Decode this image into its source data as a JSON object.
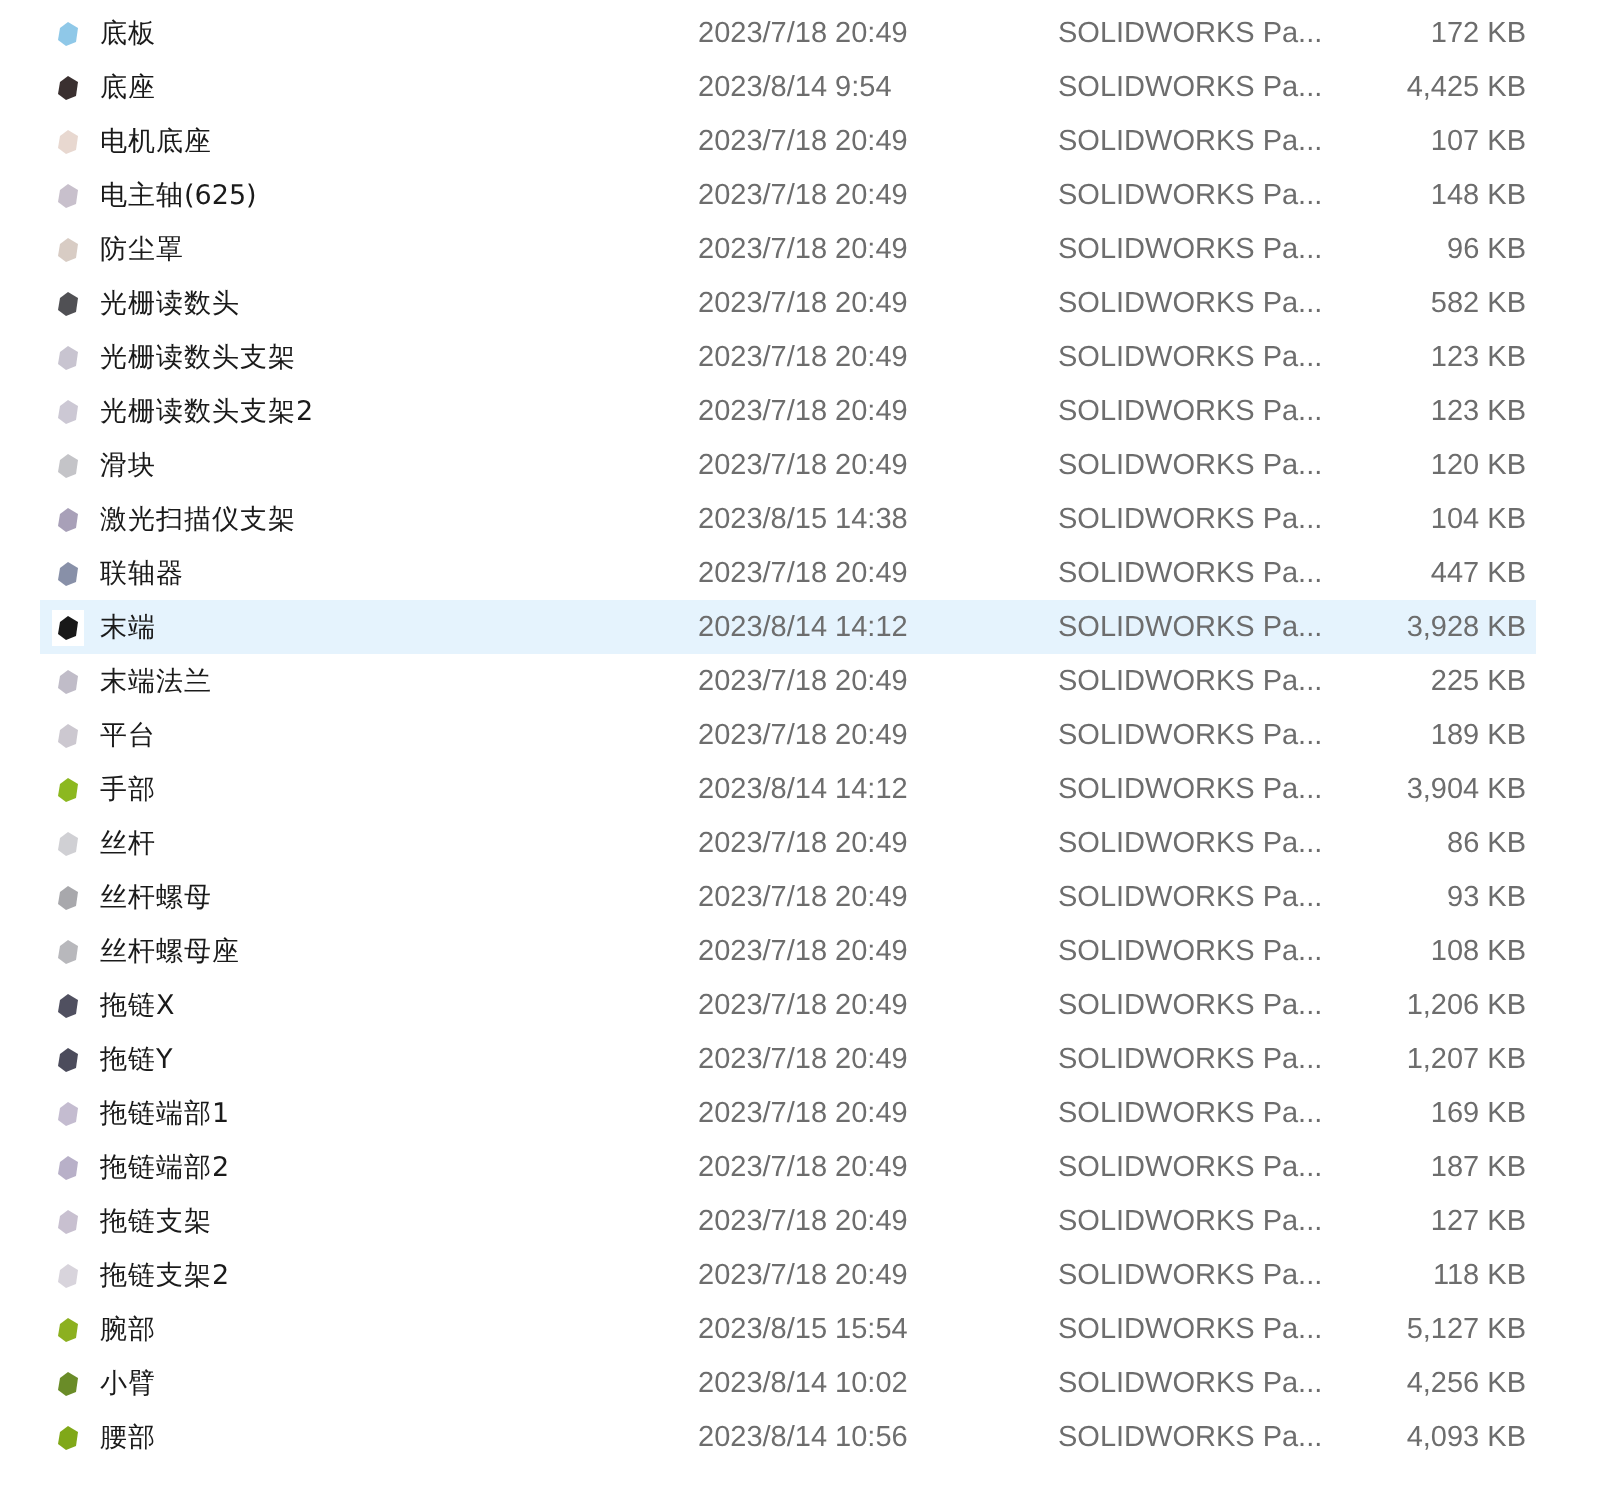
{
  "files": [
    {
      "name": "底板",
      "modified": "2023/7/18 20:49",
      "type": "SOLIDWORKS Pa...",
      "size": "172 KB",
      "selected": false,
      "color": "#8fc8e8"
    },
    {
      "name": "底座",
      "modified": "2023/8/14 9:54",
      "type": "SOLIDWORKS Pa...",
      "size": "4,425 KB",
      "selected": false,
      "color": "#3a3030"
    },
    {
      "name": "电机底座",
      "modified": "2023/7/18 20:49",
      "type": "SOLIDWORKS Pa...",
      "size": "107 KB",
      "selected": false,
      "color": "#e8d8d0"
    },
    {
      "name": "电主轴(625)",
      "modified": "2023/7/18 20:49",
      "type": "SOLIDWORKS Pa...",
      "size": "148 KB",
      "selected": false,
      "color": "#c8c0cc"
    },
    {
      "name": "防尘罩",
      "modified": "2023/7/18 20:49",
      "type": "SOLIDWORKS Pa...",
      "size": "96 KB",
      "selected": false,
      "color": "#d8ccc4"
    },
    {
      "name": "光栅读数头",
      "modified": "2023/7/18 20:49",
      "type": "SOLIDWORKS Pa...",
      "size": "582 KB",
      "selected": false,
      "color": "#505054"
    },
    {
      "name": "光栅读数头支架",
      "modified": "2023/7/18 20:49",
      "type": "SOLIDWORKS Pa...",
      "size": "123 KB",
      "selected": false,
      "color": "#c8c4d0"
    },
    {
      "name": "光栅读数头支架2",
      "modified": "2023/7/18 20:49",
      "type": "SOLIDWORKS Pa...",
      "size": "123 KB",
      "selected": false,
      "color": "#ccc8d4"
    },
    {
      "name": "滑块",
      "modified": "2023/7/18 20:49",
      "type": "SOLIDWORKS Pa...",
      "size": "120 KB",
      "selected": false,
      "color": "#c4c4c8"
    },
    {
      "name": "激光扫描仪支架",
      "modified": "2023/8/15 14:38",
      "type": "SOLIDWORKS Pa...",
      "size": "104 KB",
      "selected": false,
      "color": "#a8a0b8"
    },
    {
      "name": "联轴器",
      "modified": "2023/7/18 20:49",
      "type": "SOLIDWORKS Pa...",
      "size": "447 KB",
      "selected": false,
      "color": "#8890a8"
    },
    {
      "name": "末端",
      "modified": "2023/8/14 14:12",
      "type": "SOLIDWORKS Pa...",
      "size": "3,928 KB",
      "selected": true,
      "color": "#181818"
    },
    {
      "name": "末端法兰",
      "modified": "2023/7/18 20:49",
      "type": "SOLIDWORKS Pa...",
      "size": "225 KB",
      "selected": false,
      "color": "#c0bcc8"
    },
    {
      "name": "平台",
      "modified": "2023/7/18 20:49",
      "type": "SOLIDWORKS Pa...",
      "size": "189 KB",
      "selected": false,
      "color": "#ccc8d0"
    },
    {
      "name": "手部",
      "modified": "2023/8/14 14:12",
      "type": "SOLIDWORKS Pa...",
      "size": "3,904 KB",
      "selected": false,
      "color": "#8cb820"
    },
    {
      "name": "丝杆",
      "modified": "2023/7/18 20:49",
      "type": "SOLIDWORKS Pa...",
      "size": "86 KB",
      "selected": false,
      "color": "#d0d0d4"
    },
    {
      "name": "丝杆螺母",
      "modified": "2023/7/18 20:49",
      "type": "SOLIDWORKS Pa...",
      "size": "93 KB",
      "selected": false,
      "color": "#a8a8ac"
    },
    {
      "name": "丝杆螺母座",
      "modified": "2023/7/18 20:49",
      "type": "SOLIDWORKS Pa...",
      "size": "108 KB",
      "selected": false,
      "color": "#b8b8bc"
    },
    {
      "name": "拖链X",
      "modified": "2023/7/18 20:49",
      "type": "SOLIDWORKS Pa...",
      "size": "1,206 KB",
      "selected": false,
      "color": "#505060"
    },
    {
      "name": "拖链Y",
      "modified": "2023/7/18 20:49",
      "type": "SOLIDWORKS Pa...",
      "size": "1,207 KB",
      "selected": false,
      "color": "#4c4c5c"
    },
    {
      "name": "拖链端部1",
      "modified": "2023/7/18 20:49",
      "type": "SOLIDWORKS Pa...",
      "size": "169 KB",
      "selected": false,
      "color": "#c4bcd0"
    },
    {
      "name": "拖链端部2",
      "modified": "2023/7/18 20:49",
      "type": "SOLIDWORKS Pa...",
      "size": "187 KB",
      "selected": false,
      "color": "#b8b0c8"
    },
    {
      "name": "拖链支架",
      "modified": "2023/7/18 20:49",
      "type": "SOLIDWORKS Pa...",
      "size": "127 KB",
      "selected": false,
      "color": "#c8c0d0"
    },
    {
      "name": "拖链支架2",
      "modified": "2023/7/18 20:49",
      "type": "SOLIDWORKS Pa...",
      "size": "118 KB",
      "selected": false,
      "color": "#d8d4dc"
    },
    {
      "name": "腕部",
      "modified": "2023/8/15 15:54",
      "type": "SOLIDWORKS Pa...",
      "size": "5,127 KB",
      "selected": false,
      "color": "#8cb020"
    },
    {
      "name": "小臂",
      "modified": "2023/8/14 10:02",
      "type": "SOLIDWORKS Pa...",
      "size": "4,256 KB",
      "selected": false,
      "color": "#6a8c28"
    },
    {
      "name": "腰部",
      "modified": "2023/8/14 10:56",
      "type": "SOLIDWORKS Pa...",
      "size": "4,093 KB",
      "selected": false,
      "color": "#80a818"
    }
  ]
}
